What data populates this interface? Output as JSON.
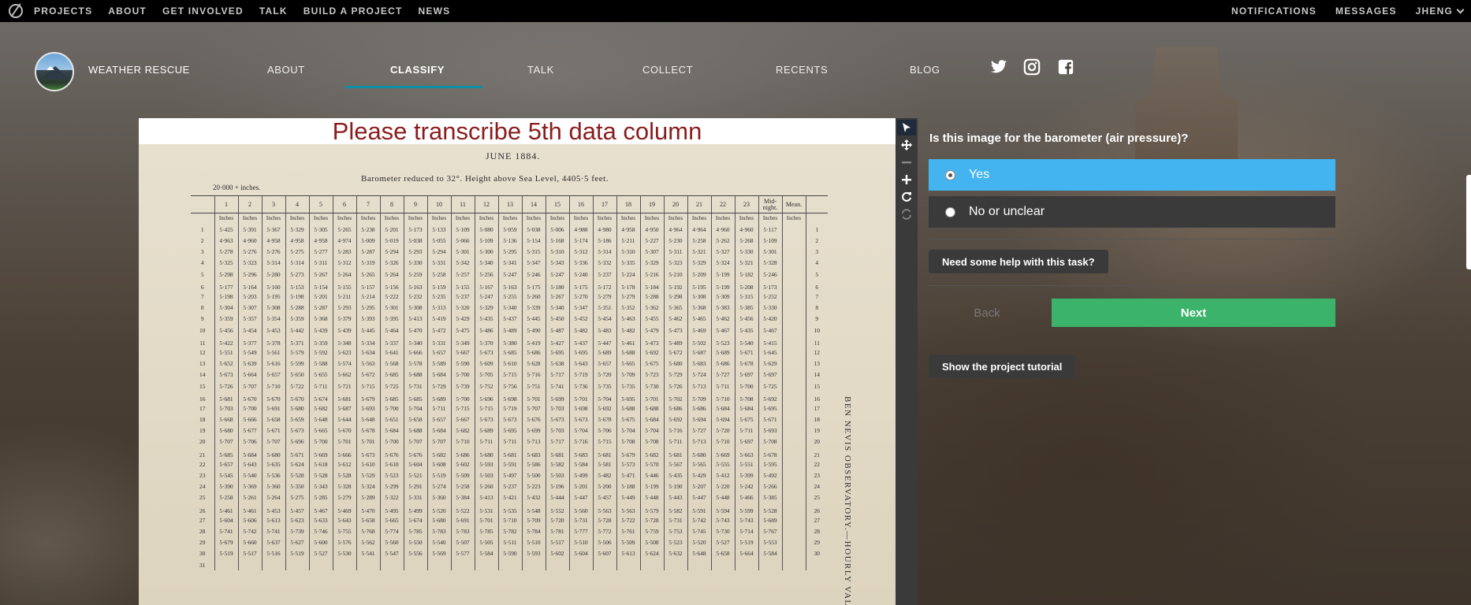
{
  "topbar": {
    "links": [
      "PROJECTS",
      "ABOUT",
      "GET INVOLVED",
      "TALK",
      "BUILD A PROJECT",
      "NEWS"
    ],
    "right": {
      "notifications": "NOTIFICATIONS",
      "messages": "MESSAGES",
      "user": "JHENG"
    }
  },
  "project": {
    "title": "WEATHER RESCUE",
    "nav": {
      "about": "ABOUT",
      "classify": "CLASSIFY",
      "talk": "TALK",
      "collect": "COLLECT",
      "recents": "RECENTS",
      "blog": "BLOG"
    },
    "social": [
      "twitter-icon",
      "instagram-icon",
      "facebook-icon"
    ]
  },
  "viewer": {
    "banner": "Please transcribe 5th data column",
    "scan": {
      "month": "JUNE 1884.",
      "subtitle": "Barometer reduced to 32°.   Height above Sea Level, 4405·5 feet.",
      "note": "20·000 + inches.",
      "vertical_title": "BEN NEVIS OBSERVATORY.—HOURLY VALUES.",
      "hours": [
        "1",
        "2",
        "3",
        "4",
        "5",
        "6",
        "7",
        "8",
        "9",
        "10",
        "11",
        "12",
        "13",
        "14",
        "15",
        "16",
        "17",
        "18",
        "19",
        "20",
        "21",
        "22",
        "23",
        "Mid-night.",
        "Mean."
      ],
      "unit": "Inches",
      "rows": [
        {
          "d": "1",
          "v": [
            "5·425",
            "5·391",
            "5·367",
            "5·329",
            "5·305",
            "5·265",
            "5·238",
            "5·201",
            "5·173",
            "5·133",
            "5·109",
            "5·080",
            "5·059",
            "5·038",
            "5·006",
            "4·988",
            "4·980",
            "4·958",
            "4·950",
            "4·964",
            "4·964",
            "4·960",
            "4·960",
            "5·117"
          ]
        },
        {
          "d": "2",
          "v": [
            "4·963",
            "4·960",
            "4·958",
            "4·958",
            "4·958",
            "4·974",
            "5·009",
            "5·019",
            "5·038",
            "5·055",
            "5·066",
            "5·109",
            "5·136",
            "5·154",
            "5·168",
            "5·174",
            "5·186",
            "5·211",
            "5·227",
            "5·230",
            "5·258",
            "5·262",
            "5·268",
            "5·109"
          ]
        },
        {
          "d": "3",
          "v": [
            "5·278",
            "5·276",
            "5·276",
            "5·275",
            "5·277",
            "5·283",
            "5·287",
            "5·294",
            "5·293",
            "5·294",
            "5·301",
            "5·300",
            "5·295",
            "5·315",
            "5·310",
            "5·312",
            "5·314",
            "5·310",
            "5·307",
            "5·311",
            "5·321",
            "5·327",
            "5·330",
            "5·301"
          ]
        },
        {
          "d": "4",
          "v": [
            "5·325",
            "5·323",
            "5·314",
            "5·314",
            "5·311",
            "5·312",
            "5·319",
            "5·326",
            "5·330",
            "5·331",
            "5·342",
            "5·340",
            "5·341",
            "5·347",
            "5·343",
            "5·336",
            "5·332",
            "5·335",
            "5·329",
            "5·323",
            "5·329",
            "5·324",
            "5·321",
            "5·328"
          ]
        },
        {
          "d": "5",
          "v": [
            "5·298",
            "5·296",
            "5·280",
            "5·273",
            "5·267",
            "5·264",
            "5·265",
            "5·264",
            "5·259",
            "5·258",
            "5·257",
            "5·256",
            "5·247",
            "5·246",
            "5·247",
            "5·240",
            "5·237",
            "5·224",
            "5·216",
            "5·210",
            "5·209",
            "5·199",
            "5·182",
            "5·246"
          ]
        },
        {
          "d": "6",
          "v": [
            "5·177",
            "5·164",
            "5·160",
            "5·153",
            "5·154",
            "5·155",
            "5·157",
            "5·156",
            "5·163",
            "5·159",
            "5·155",
            "5·167",
            "5·163",
            "5·175",
            "5·180",
            "5·175",
            "5·172",
            "5·178",
            "5·184",
            "5·192",
            "5·195",
            "5·199",
            "5·208",
            "5·173"
          ]
        },
        {
          "d": "7",
          "v": [
            "5·198",
            "5·203",
            "5·195",
            "5·198",
            "5·201",
            "5·211",
            "5·214",
            "5·222",
            "5·232",
            "5·235",
            "5·237",
            "5·247",
            "5·255",
            "5·260",
            "5·267",
            "5·270",
            "5·279",
            "5·279",
            "5·288",
            "5·298",
            "5·308",
            "5·309",
            "5·315",
            "5·252"
          ]
        },
        {
          "d": "8",
          "v": [
            "5·304",
            "5·307",
            "5·308",
            "5·288",
            "5·287",
            "5·293",
            "5·295",
            "5·301",
            "5·308",
            "5·313",
            "5·320",
            "5·329",
            "5·340",
            "5·339",
            "5·340",
            "5·347",
            "5·351",
            "5·352",
            "5·362",
            "5·365",
            "5·368",
            "5·383",
            "5·385",
            "5·330"
          ]
        },
        {
          "d": "9",
          "v": [
            "5·359",
            "5·357",
            "5·354",
            "5·359",
            "5·368",
            "5·379",
            "5·393",
            "5·395",
            "5·413",
            "5·419",
            "5·429",
            "5·435",
            "5·437",
            "5·445",
            "5·450",
            "5·452",
            "5·454",
            "5·463",
            "5·455",
            "5·462",
            "5·465",
            "5·462",
            "5·456",
            "5·420"
          ]
        },
        {
          "d": "10",
          "v": [
            "5·456",
            "5·454",
            "5·453",
            "5·442",
            "5·439",
            "5·439",
            "5·445",
            "5·464",
            "5·470",
            "5·472",
            "5·475",
            "5·486",
            "5·489",
            "5·490",
            "5·487",
            "5·482",
            "5·483",
            "5·482",
            "5·479",
            "5·473",
            "5·469",
            "5·467",
            "5·435",
            "5·467"
          ]
        },
        {
          "d": "11",
          "v": [
            "5·422",
            "5·377",
            "5·378",
            "5·371",
            "5·359",
            "5·348",
            "5·334",
            "5·337",
            "5·340",
            "5·331",
            "5·349",
            "5·370",
            "5·380",
            "5·419",
            "5·427",
            "5·437",
            "5·447",
            "5·461",
            "5·473",
            "5·489",
            "5·502",
            "5·523",
            "5·540",
            "5·415"
          ]
        },
        {
          "d": "12",
          "v": [
            "5·551",
            "5·549",
            "5·561",
            "5·579",
            "5·592",
            "5·623",
            "5·634",
            "5·641",
            "5·666",
            "5·657",
            "5·667",
            "5·673",
            "5·685",
            "5·686",
            "5·695",
            "5·695",
            "5·689",
            "5·688",
            "5·692",
            "5·672",
            "5·687",
            "5·689",
            "5·671",
            "5·645"
          ]
        },
        {
          "d": "13",
          "v": [
            "5·652",
            "5·639",
            "5·616",
            "5·599",
            "5·588",
            "5·574",
            "5·563",
            "5·568",
            "5·578",
            "5·589",
            "5·590",
            "5·609",
            "5·610",
            "5·628",
            "5·638",
            "5·643",
            "5·657",
            "5·665",
            "5·675",
            "5·680",
            "5·683",
            "5·686",
            "5·678",
            "5·629"
          ]
        },
        {
          "d": "14",
          "v": [
            "5·673",
            "5·664",
            "5·657",
            "5·650",
            "5·655",
            "5·662",
            "5·672",
            "5·685",
            "5·688",
            "5·684",
            "5·700",
            "5·705",
            "5·715",
            "5·716",
            "5·717",
            "5·719",
            "5·720",
            "5·709",
            "5·723",
            "5·729",
            "5·724",
            "5·727",
            "5·697",
            "5·697"
          ]
        },
        {
          "d": "15",
          "v": [
            "5·726",
            "5·707",
            "5·710",
            "5·722",
            "5·711",
            "5·721",
            "5·715",
            "5·725",
            "5·731",
            "5·729",
            "5·739",
            "5·752",
            "5·756",
            "5·751",
            "5·741",
            "5·736",
            "5·735",
            "5·735",
            "5·730",
            "5·726",
            "5·713",
            "5·711",
            "5·700",
            "5·725"
          ]
        },
        {
          "d": "16",
          "v": [
            "5·681",
            "5·670",
            "5·670",
            "5·670",
            "5·674",
            "5·681",
            "5·679",
            "5·685",
            "5·685",
            "5·689",
            "5·700",
            "5·696",
            "5·698",
            "5·701",
            "5·699",
            "5·701",
            "5·704",
            "5·695",
            "5·701",
            "5·702",
            "5·709",
            "5·710",
            "5·708",
            "5·692"
          ]
        },
        {
          "d": "17",
          "v": [
            "5·703",
            "5·700",
            "5·691",
            "5·680",
            "5·682",
            "5·687",
            "5·693",
            "5·700",
            "5·704",
            "5·711",
            "5·715",
            "5·715",
            "5·719",
            "5·707",
            "5·703",
            "5·698",
            "5·692",
            "5·688",
            "5·688",
            "5·686",
            "5·686",
            "5·684",
            "5·684",
            "5·695"
          ]
        },
        {
          "d": "18",
          "v": [
            "5·668",
            "5·666",
            "5·658",
            "5·659",
            "5·648",
            "5·644",
            "5·648",
            "5·651",
            "5·658",
            "5·657",
            "5·667",
            "5·673",
            "5·673",
            "5·676",
            "5·673",
            "5·673",
            "5·678",
            "5·675",
            "5·684",
            "5·692",
            "5·694",
            "5·694",
            "5·675",
            "5·671"
          ]
        },
        {
          "d": "19",
          "v": [
            "5·680",
            "5·677",
            "5·671",
            "5·673",
            "5·665",
            "5·670",
            "5·678",
            "5·684",
            "5·688",
            "5·684",
            "5·682",
            "5·689",
            "5·695",
            "5·699",
            "5·703",
            "5·704",
            "5·706",
            "5·704",
            "5·704",
            "5·716",
            "5·727",
            "5·720",
            "5·711",
            "5·693"
          ]
        },
        {
          "d": "20",
          "v": [
            "5·707",
            "5·706",
            "5·707",
            "5·696",
            "5·700",
            "5·701",
            "5·701",
            "5·700",
            "5·707",
            "5·707",
            "5·710",
            "5·711",
            "5·711",
            "5·713",
            "5·717",
            "5·716",
            "5·715",
            "5·708",
            "5·708",
            "5·711",
            "5·713",
            "5·710",
            "5·697",
            "5·708"
          ]
        },
        {
          "d": "21",
          "v": [
            "5·685",
            "5·684",
            "5·680",
            "5·671",
            "5·669",
            "5·666",
            "5·673",
            "5·676",
            "5·676",
            "5·682",
            "5·686",
            "5·680",
            "5·681",
            "5·683",
            "5·681",
            "5·683",
            "5·681",
            "5·679",
            "5·682",
            "5·681",
            "5·680",
            "5·669",
            "5·663",
            "5·678"
          ]
        },
        {
          "d": "22",
          "v": [
            "5·657",
            "5·643",
            "5·635",
            "5·624",
            "5·618",
            "5·612",
            "5·610",
            "5·610",
            "5·604",
            "5·608",
            "5·602",
            "5·593",
            "5·591",
            "5·586",
            "5·582",
            "5·584",
            "5·581",
            "5·573",
            "5·570",
            "5·567",
            "5·565",
            "5·555",
            "5·551",
            "5·595"
          ]
        },
        {
          "d": "23",
          "v": [
            "5·545",
            "5·540",
            "5·536",
            "5·528",
            "5·528",
            "5·528",
            "5·529",
            "5·523",
            "5·521",
            "5·519",
            "5·509",
            "5·503",
            "5·497",
            "5·500",
            "5·503",
            "5·499",
            "5·482",
            "5·471",
            "5·446",
            "5·435",
            "5·429",
            "5·412",
            "5·399",
            "5·492"
          ]
        },
        {
          "d": "24",
          "v": [
            "5·390",
            "5·369",
            "5·360",
            "5·350",
            "5·343",
            "5·328",
            "5·324",
            "5·299",
            "5·291",
            "5·274",
            "5·258",
            "5·260",
            "5·237",
            "5·223",
            "5·196",
            "5·201",
            "5·200",
            "5·188",
            "5·199",
            "5·190",
            "5·207",
            "5·220",
            "5·242",
            "5·266"
          ]
        },
        {
          "d": "25",
          "v": [
            "5·258",
            "5·261",
            "5·264",
            "5·275",
            "5·285",
            "5·279",
            "5·289",
            "5·322",
            "5·331",
            "5·360",
            "5·384",
            "5·413",
            "5·421",
            "5·432",
            "5·444",
            "5·447",
            "5·457",
            "5·449",
            "5·448",
            "5·443",
            "5·447",
            "5·448",
            "5·466",
            "5·385"
          ]
        },
        {
          "d": "26",
          "v": [
            "5·461",
            "5·461",
            "5·453",
            "5·457",
            "5·467",
            "5·469",
            "5·470",
            "5·495",
            "5·499",
            "5·520",
            "5·522",
            "5·531",
            "5·535",
            "5·548",
            "5·552",
            "5·560",
            "5·563",
            "5·563",
            "5·579",
            "5·582",
            "5·591",
            "5·594",
            "5·599",
            "5·528"
          ]
        },
        {
          "d": "27",
          "v": [
            "5·604",
            "5·606",
            "5·613",
            "5·623",
            "5·633",
            "5·643",
            "5·658",
            "5·665",
            "5·674",
            "5·680",
            "5·691",
            "5·701",
            "5·710",
            "5·709",
            "5·720",
            "5·731",
            "5·728",
            "5·722",
            "5·728",
            "5·731",
            "5·742",
            "5·743",
            "5·743",
            "5·689"
          ]
        },
        {
          "d": "28",
          "v": [
            "5·741",
            "5·742",
            "5·741",
            "5·739",
            "5·746",
            "5·755",
            "5·768",
            "5·774",
            "5·785",
            "5·783",
            "5·783",
            "5·785",
            "5·782",
            "5·784",
            "5·781",
            "5·777",
            "5·772",
            "5·761",
            "5·759",
            "5·753",
            "5·745",
            "5·730",
            "5·714",
            "5·767"
          ]
        },
        {
          "d": "29",
          "v": [
            "5·679",
            "5·660",
            "5·637",
            "5·627",
            "5·600",
            "5·576",
            "5·562",
            "5·560",
            "5·550",
            "5·540",
            "5·507",
            "5·505",
            "5·511",
            "5·510",
            "5·517",
            "5·510",
            "5·506",
            "5·509",
            "5·508",
            "5·523",
            "5·520",
            "5·527",
            "5·519",
            "5·553"
          ]
        },
        {
          "d": "30",
          "v": [
            "5·519",
            "5·517",
            "5·516",
            "5·519",
            "5·527",
            "5·530",
            "5·541",
            "5·547",
            "5·556",
            "5·569",
            "5·577",
            "5·584",
            "5·590",
            "5·593",
            "5·602",
            "5·604",
            "5·607",
            "5·613",
            "5·624",
            "5·632",
            "5·648",
            "5·658",
            "5·664",
            "5·584"
          ]
        },
        {
          "d": "31",
          "v": []
        }
      ]
    }
  },
  "tools": [
    "pointer-icon",
    "move-icon",
    "zoom-out-icon",
    "zoom-in-icon",
    "rotate-icon",
    "reset-icon"
  ],
  "task": {
    "question": "Is this image for the barometer (air pressure)?",
    "answers": [
      {
        "label": "Yes",
        "selected": true
      },
      {
        "label": "No or unclear",
        "selected": false
      }
    ],
    "help_label": "Need some help with this task?",
    "back_label": "Back",
    "next_label": "Next",
    "tutorial_label": "Show the project tutorial"
  },
  "colors": {
    "selected": "#43b4f0",
    "next": "#3bb36a",
    "active_underline": "#0f8fa5",
    "banner_text": "#8a1d1d"
  }
}
